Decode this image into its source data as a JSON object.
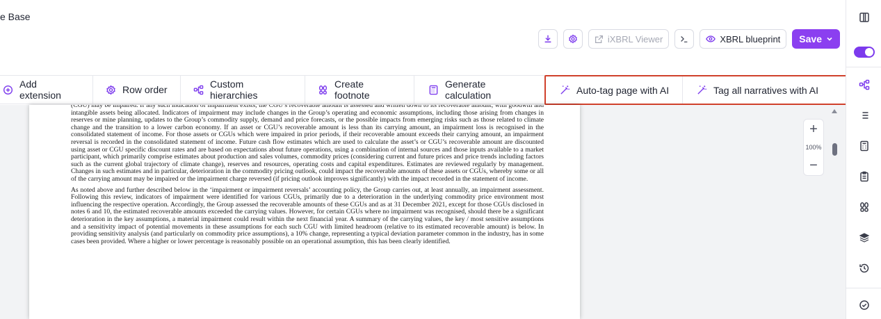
{
  "header": {
    "title": "e Base",
    "ixbrl_viewer_label": "iXBRL Viewer",
    "xbrl_blueprint_label": "XBRL blueprint",
    "save_label": "Save"
  },
  "toolbar": {
    "items": [
      {
        "label": "Add extension",
        "icon": "plus-circle-icon"
      },
      {
        "label": "Row order",
        "icon": "gear-icon"
      },
      {
        "label": "Custom hierarchies",
        "icon": "hierarchy-icon"
      },
      {
        "label": "Create footnote",
        "icon": "footprint-icon"
      },
      {
        "label": "Generate calculation",
        "icon": "calculator-icon"
      }
    ],
    "ai_items": [
      {
        "label": "Auto-tag page with AI",
        "icon": "magic-wand-icon"
      },
      {
        "label": "Tag all narratives with AI",
        "icon": "magic-wand-icon"
      }
    ]
  },
  "document": {
    "paragraphs": [
      "(CGU) may be impaired. If any such indication of impairment exists, the CGU’s recoverable amount is assessed and written down to its recoverable amount, with goodwill and intangible assets being allocated. Indicators of impairment may include changes in the Group’s operating and economic assumptions, including those arising from changes in reserves or mine planning, updates to the Group’s commodity supply, demand and price forecasts, or the possible impacts from emerging risks such as those related to climate change and the transition to a lower carbon economy. If an asset or CGU’s recoverable amount is less than its carrying amount, an impairment loss is recognised in the consolidated statement of income. For those assets or CGUs which were impaired in prior periods, if their recoverable amount exceeds their carrying amount, an impairment reversal is recorded in the consolidated statement of income. Future cash flow estimates which are used to calculate the asset’s or CGU’s recoverable amount are discounted using asset or CGU specific discount rates and are based on expectations about future operations, using a combination of internal sources and those inputs available to a market participant, which primarily comprise estimates about production and sales volumes, commodity prices (considering current and future prices and price trends including factors such as the current global trajectory of climate change), reserves and resources, operating costs and capital expenditures. Estimates are reviewed regularly by management. Changes in such estimates and in particular, deterioration in the commodity pricing outlook, could impact the recoverable amounts of these assets or CGUs, whereby some or all of the carrying amount may be impaired or the impairment charge reversed (if pricing outlook improves significantly) with the impact recorded in the statement of income.",
      "As noted above and further described below in the ‘impairment or impairment reversals’ accounting policy, the Group carries out, at least annually, an impairment assessment. Following this review, indicators of impairment were identified for various CGUs, primarily due to a deterioration in the underlying commodity price environment most influencing the respective operation. Accordingly, the Group assessed the recoverable amounts of these CGUs and as at 31 December 2021, except for those CGUs disclosed in notes 6 and 10, the estimated recoverable amounts exceeded the carrying values. However, for certain CGUs where no impairment was recognised, should there be a significant deterioration in the key assumptions, a material impairment could result within the next financial year. A summary of the carrying values, the key / most sensitive assumptions and a sensitivity impact of potential movements in these assumptions for each such CGU with limited headroom (relative to its estimated recoverable amount) is below. In providing sensitivity analysis (and particularly on commodity price assumptions), a 10% change, representing a typical deviation parameter common in the industry, has in some cases been provided. Where a higher or lower percentage is reasonably possible on an operational assumption, this has been clearly identified."
    ]
  },
  "zoom": {
    "plus": "+",
    "level": "100%",
    "minus": "−"
  },
  "colors": {
    "accent": "#7c3aed",
    "save": "#8b3ff0",
    "highlight_border": "#d0402b"
  }
}
